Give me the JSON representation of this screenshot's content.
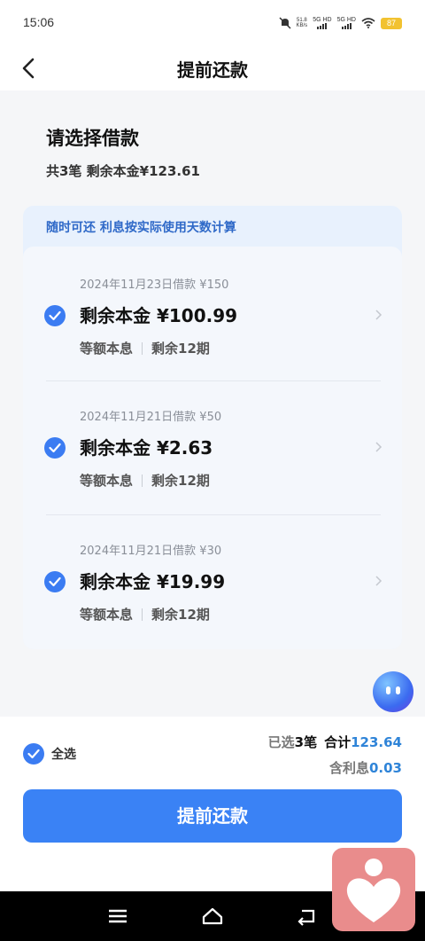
{
  "status_bar": {
    "time": "15:06",
    "net_speed_value": "51.8",
    "net_speed_unit": "KB/s",
    "sim1": "5G HD",
    "sim2": "5G HD",
    "battery": "87"
  },
  "header": {
    "title": "提前还款"
  },
  "intro": {
    "title": "请选择借款",
    "summary": "共3笔 剩余本金¥123.61"
  },
  "notice": "随时可还 利息按实际使用天数计算",
  "loans": [
    {
      "date_amount": "2024年11月23日借款 ¥150",
      "remaining": "剩余本金 ¥100.99",
      "method": "等额本息",
      "periods": "剩余12期",
      "checked": true
    },
    {
      "date_amount": "2024年11月21日借款 ¥50",
      "remaining": "剩余本金 ¥2.63",
      "method": "等额本息",
      "periods": "剩余12期",
      "checked": true
    },
    {
      "date_amount": "2024年11月21日借款 ¥30",
      "remaining": "剩余本金 ¥19.99",
      "method": "等额本息",
      "periods": "剩余12期",
      "checked": true
    }
  ],
  "footer": {
    "select_all": "全选",
    "selected_prefix": "已选",
    "selected_count": "3笔",
    "total_label": "合计",
    "total_value": "123.64",
    "interest_label": "含利息",
    "interest_value": "0.03",
    "button": "提前还款"
  },
  "colors": {
    "accent": "#3a82f5",
    "amount_blue": "#2f84d8",
    "notice_bg": "#e8f1fd"
  },
  "icons": [
    "back-arrow-icon",
    "checkmark-icon",
    "chevron-right-icon",
    "assistant-icon",
    "heart-icon",
    "menu-icon",
    "home-icon",
    "back-icon",
    "wifi-icon",
    "mute-icon"
  ]
}
